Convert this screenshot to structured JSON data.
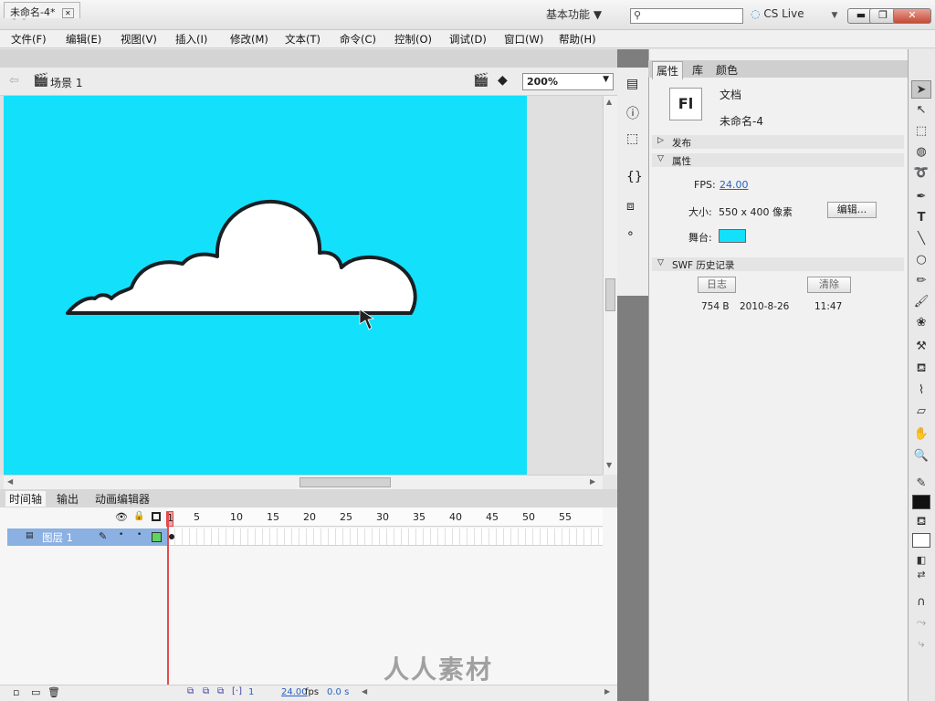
{
  "app": {
    "logo": "Fl",
    "workspace": "基本功能 ▼",
    "search_placeholder": "",
    "cslive": "CS Live"
  },
  "window_controls": {
    "minimize": "▬",
    "restore": "❐",
    "close": "✕"
  },
  "menu": [
    "文件(F)",
    "编辑(E)",
    "视图(V)",
    "插入(I)",
    "修改(M)",
    "文本(T)",
    "命令(C)",
    "控制(O)",
    "调试(D)",
    "窗口(W)",
    "帮助(H)"
  ],
  "document": {
    "tab_label": "未命名-4*",
    "tab_close": "✕",
    "scene": "场景 1",
    "zoom": "200%",
    "stage_color": "#13e0fb"
  },
  "timeline": {
    "tabs": [
      "时间轴",
      "输出",
      "动画编辑器"
    ],
    "ruler": [
      "1",
      "5",
      "10",
      "15",
      "20",
      "25",
      "30",
      "35",
      "40",
      "45",
      "50",
      "55"
    ],
    "layer_name": "图层 1",
    "frame": "1",
    "fps": "24.00",
    "fps_unit": "fps",
    "time": "0.0 s"
  },
  "properties": {
    "tabs": [
      "属性",
      "库",
      "颜色"
    ],
    "doc_icon": "Fl",
    "doc_type": "文档",
    "doc_name": "未命名-4",
    "section_publish": "发布",
    "section_props": "属性",
    "fps_label": "FPS:",
    "fps_value": "24.00",
    "size_label": "大小:",
    "size_value": "550 x 400 像素",
    "edit_button": "编辑...",
    "stage_label": "舞台:",
    "section_swf": "SWF 历史记录",
    "log_button": "日志",
    "clear_button": "清除",
    "history": {
      "size": "754 B",
      "date": "2010-8-26",
      "time": "11:47"
    }
  },
  "watermark": "人人素材"
}
